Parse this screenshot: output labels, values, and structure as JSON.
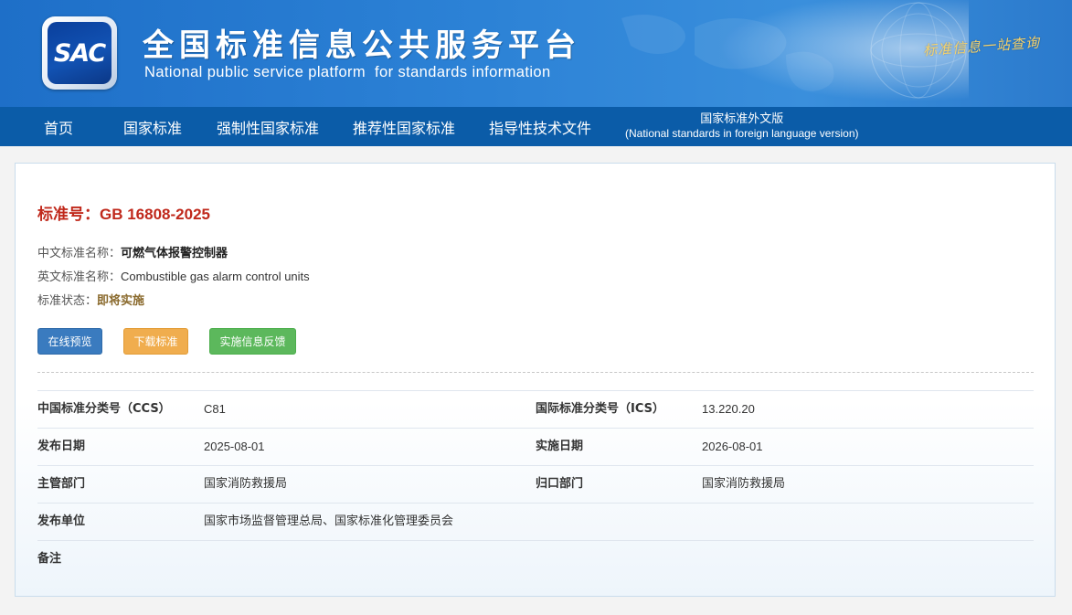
{
  "header": {
    "logo_text": "SAC",
    "title_cn": "全国标准信息公共服务平台",
    "title_en": "National public service platform  for standards information",
    "slogan": "标准信息一站查询"
  },
  "nav": {
    "items": [
      {
        "label": "首页"
      },
      {
        "label": "国家标准"
      },
      {
        "label": "强制性国家标准"
      },
      {
        "label": "推荐性国家标准"
      },
      {
        "label": "指导性技术文件"
      }
    ],
    "foreign": {
      "line1": "国家标准外文版",
      "line2": "(National standards in foreign language version)"
    }
  },
  "standard": {
    "no_label": "标准号：",
    "no_value": "GB 16808-2025",
    "cn_name_label": "中文标准名称：",
    "cn_name": "可燃气体报警控制器",
    "en_name_label": "英文标准名称：",
    "en_name": "Combustible gas alarm control units",
    "status_label": "标准状态：",
    "status": "即将实施"
  },
  "buttons": {
    "preview": "在线预览",
    "download": "下载标准",
    "feedback": "实施信息反馈"
  },
  "details": {
    "rows": [
      {
        "k1": "中国标准分类号（CCS）",
        "v1": "C81",
        "k2": "国际标准分类号（ICS）",
        "v2": "13.220.20"
      },
      {
        "k1": "发布日期",
        "v1": "2025-08-01",
        "k2": "实施日期",
        "v2": "2026-08-01"
      },
      {
        "k1": "主管部门",
        "v1": "国家消防救援局",
        "k2": "归口部门",
        "v2": "国家消防救援局"
      },
      {
        "k1": "发布单位",
        "v1": "国家市场监督管理总局、国家标准化管理委员会",
        "k2": "",
        "v2": ""
      },
      {
        "k1": "备注",
        "v1": "",
        "k2": "",
        "v2": ""
      }
    ]
  },
  "colors": {
    "header_blue": "#2c82d6",
    "nav_blue": "#0b5ca8",
    "std_red": "#c0281b",
    "status_brown": "#8a6a2d",
    "btn_blue": "#3a7bbf",
    "btn_orange": "#f0ad4e",
    "btn_green": "#5cb85c"
  }
}
